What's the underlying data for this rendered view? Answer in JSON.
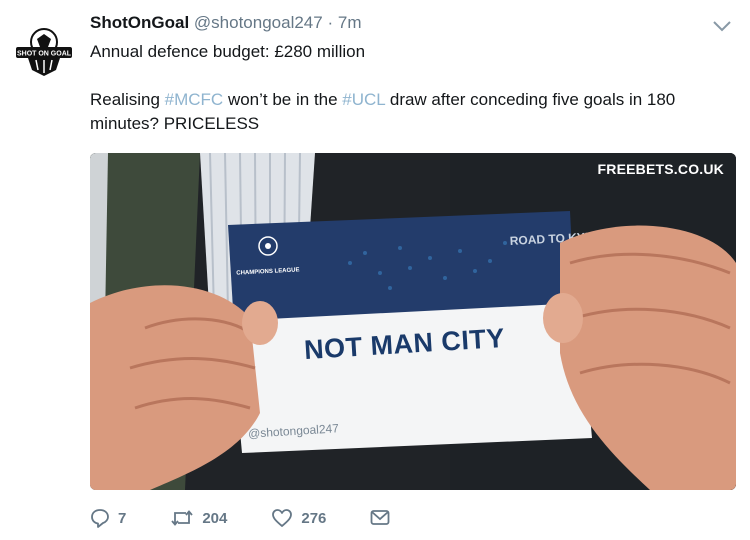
{
  "tweet": {
    "avatar_label": "SHOT ON GOAL",
    "author_name": "ShotOnGoal",
    "handle": "@shotongoal247",
    "separator": "·",
    "time": "7m",
    "text_line1": "Annual defence budget: £280 million",
    "text_p2_start": "Realising ",
    "hashtag1": "#MCFC",
    "text_p2_mid": " won’t be in the ",
    "hashtag2": "#UCL",
    "text_p2_end": " draw after conceding five goals in 180 minutes? PRICELESS"
  },
  "media": {
    "watermark": "FREEBETS.CO.UK",
    "card_text": "NOT MAN CITY",
    "card_handle": "@shotongoal247",
    "card_brand": "CHAMPIONS LEAGUE",
    "card_road": "ROAD TO KYIV"
  },
  "actions": {
    "replies": "7",
    "retweets": "204",
    "likes": "276"
  },
  "colors": {
    "hashtag": "#8fb4cf",
    "muted": "#657786",
    "text": "#14171a"
  }
}
